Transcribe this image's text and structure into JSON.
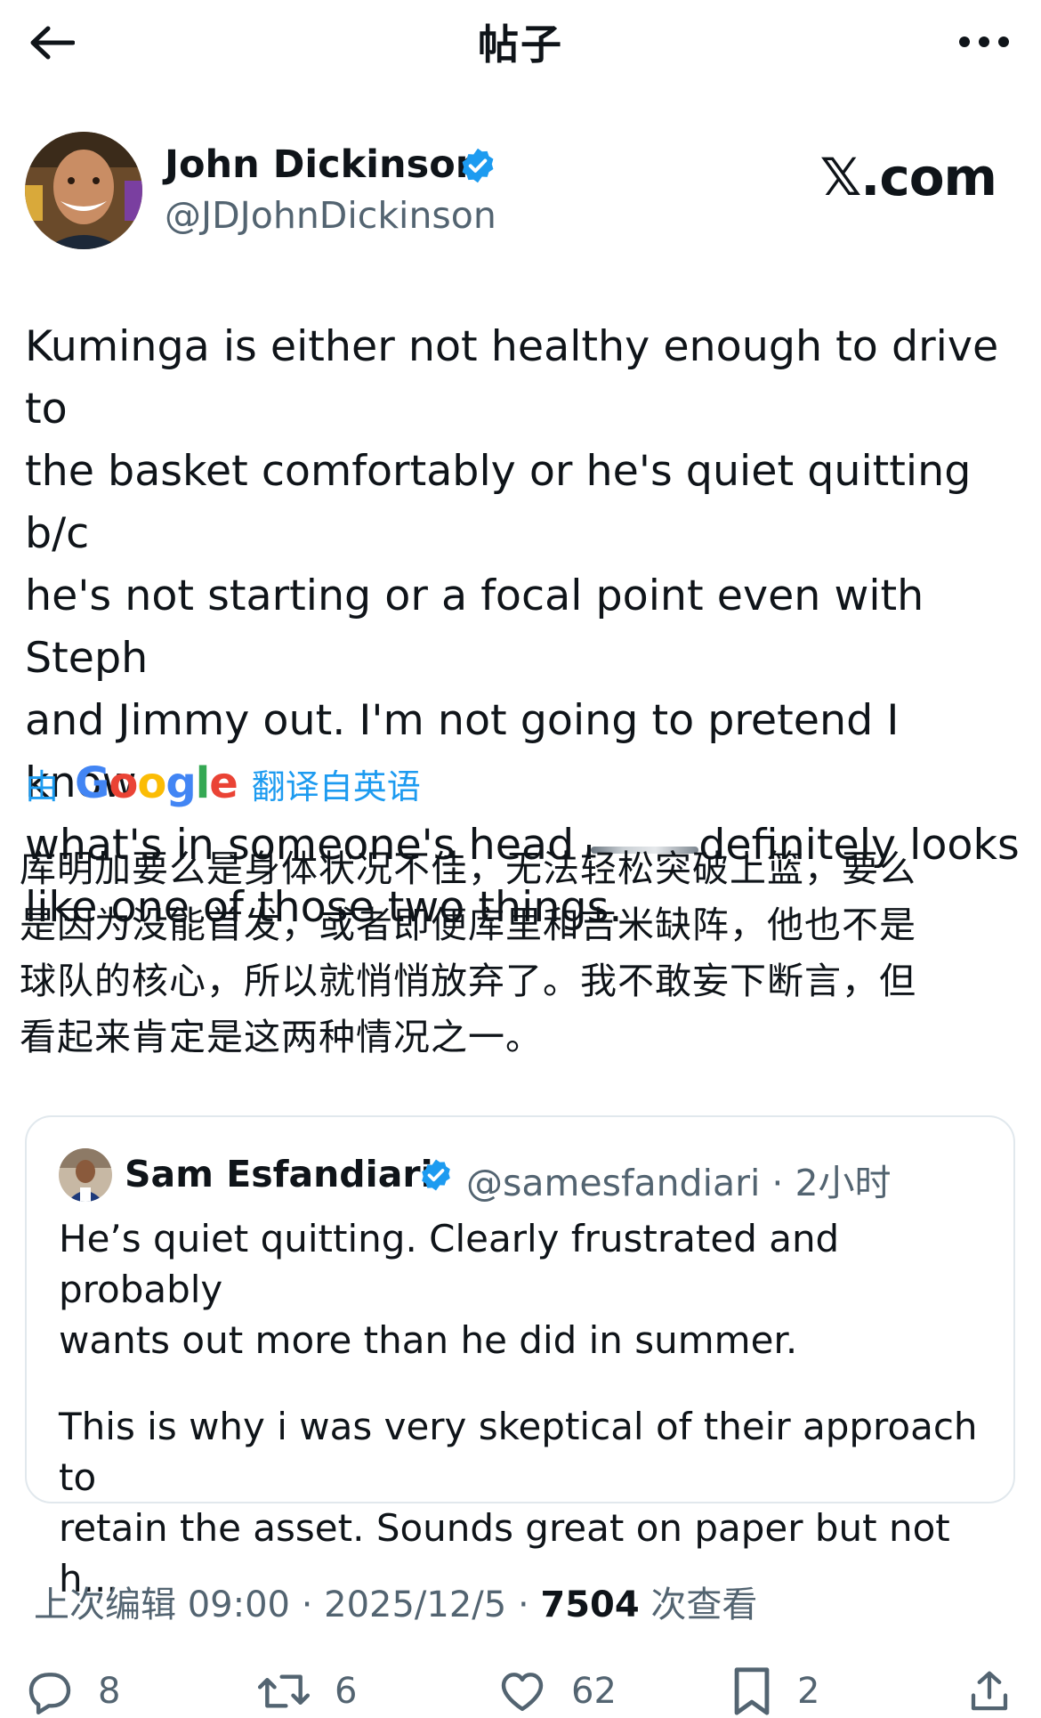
{
  "header": {
    "title": "帖子"
  },
  "author": {
    "name": "John Dickinson",
    "handle": "@JDJohnDickinson"
  },
  "site_logo": "𝕏.com",
  "tweet": {
    "line1": "Kuminga is either not healthy enough to drive to",
    "line2": "the basket comfortably or he's quiet quitting b/c",
    "line3": "he's not starting or a focal point even with Steph",
    "line4": "and Jimmy out. I'm not going to pretend I know",
    "line5_before": "what's in someone's head ",
    "line5_after": "definitely looks",
    "line6": "like one of those two things."
  },
  "translation": {
    "by": "由",
    "provider": "Google",
    "from": "翻译自英语",
    "line1": "库明加要么是身体状况不佳，无法轻松突破上篮，要么",
    "line2": "是因为没能首发，或者即便库里和吉米缺阵，他也不是",
    "line3": "球队的核心，所以就悄悄放弃了。我不敢妄下断言，但",
    "line4": "看起来肯定是这两种情况之一。"
  },
  "quote": {
    "name": "Sam Esfandiari",
    "handle_time": "@samesfandiari · 2小时",
    "para1_line1": "He’s quiet quitting. Clearly frustrated and probably",
    "para1_line2": "wants out more than he did in summer.",
    "para2_line1": "This is why i was very skeptical of their approach to",
    "para2_line2": "retain the asset. Sounds great on paper but not h..."
  },
  "meta": {
    "edited": "上次编辑 09:00 · 2025/12/5 · ",
    "views": "7504",
    "views_label": " 次查看"
  },
  "actions": {
    "replies": "8",
    "retweets": "6",
    "likes": "62",
    "bookmarks": "2"
  },
  "colors": {
    "accent": "#1d9bf0",
    "secondary_text": "#536471",
    "primary_text": "#0f1419"
  },
  "icons": [
    "back-arrow-icon",
    "more-icon",
    "verified-badge-icon",
    "reply-icon",
    "retweet-icon",
    "like-icon",
    "bookmark-icon",
    "share-icon"
  ]
}
